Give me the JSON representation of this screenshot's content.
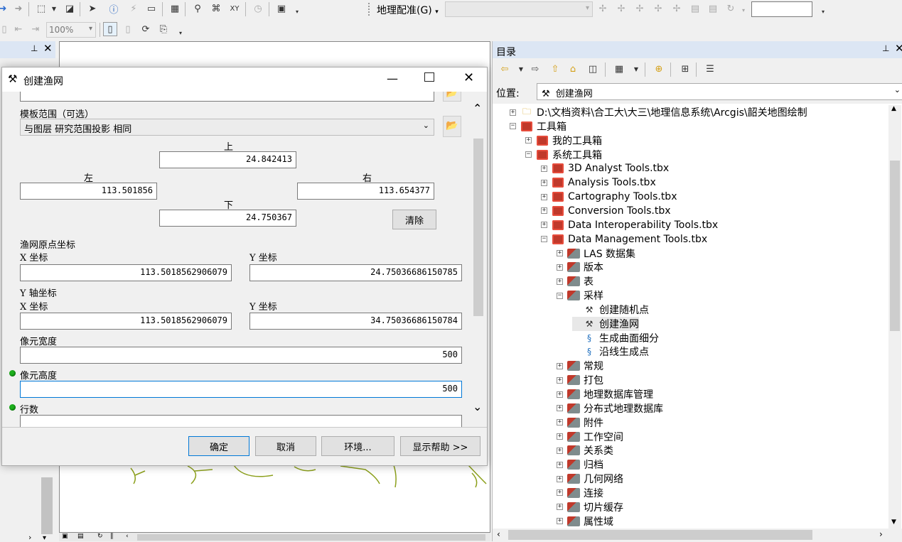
{
  "toolbar": {
    "zoom_value": "100%",
    "georef_label": "地理配准(G)"
  },
  "left_panel": {
    "pin_icon": "pin-icon",
    "close_icon": "close-icon"
  },
  "dialog": {
    "title": "创建渔网",
    "template_extent_label": "模板范围（可选）",
    "template_extent_value": "与图层 研究范围投影 相同",
    "top_label": "上",
    "top_value": "24.842413",
    "left_label": "左",
    "left_value": "113.501856",
    "right_label": "右",
    "right_value": "113.654377",
    "bottom_label": "下",
    "bottom_value": "24.750367",
    "clear_button": "清除",
    "origin_label": "渔网原点坐标",
    "origin_x_label": "X 坐标",
    "origin_x_value": "113.5018562906079",
    "origin_y_label": "Y 坐标",
    "origin_y_value": "24.75036686150785",
    "yaxis_label": "Y 轴坐标",
    "yaxis_x_label": "X 坐标",
    "yaxis_x_value": "113.5018562906079",
    "yaxis_y_label": "Y 坐标",
    "yaxis_y_value": "34.75036686150784",
    "cell_width_label": "像元宽度",
    "cell_width_value": "500",
    "cell_height_label": "像元高度",
    "cell_height_value": "500",
    "rows_label": "行数",
    "ok_button": "确定",
    "cancel_button": "取消",
    "env_button": "环境...",
    "help_button": "显示帮助 >>"
  },
  "catalog": {
    "title": "目录",
    "location_label": "位置:",
    "location_value": "创建渔网",
    "tree": [
      {
        "label": "D:\\文档资料\\合工大\\大三\\地理信息系统\\Arcgis\\韶关地图绘制",
        "pm": "+",
        "icon": "folder-icon"
      },
      {
        "label": "工具箱",
        "pm": "-",
        "icon": "toolbox-icon"
      },
      {
        "label": "我的工具箱",
        "pm": "+",
        "icon": "toolbox-icon"
      },
      {
        "label": "系统工具箱",
        "pm": "-",
        "icon": "toolbox-icon"
      },
      {
        "label": "3D Analyst Tools.tbx",
        "pm": "+",
        "icon": "toolbox-icon"
      },
      {
        "label": "Analysis Tools.tbx",
        "pm": "+",
        "icon": "toolbox-icon"
      },
      {
        "label": "Cartography Tools.tbx",
        "pm": "+",
        "icon": "toolbox-icon"
      },
      {
        "label": "Conversion Tools.tbx",
        "pm": "+",
        "icon": "toolbox-icon"
      },
      {
        "label": "Data Interoperability Tools.tbx",
        "pm": "+",
        "icon": "toolbox-icon"
      },
      {
        "label": "Data Management Tools.tbx",
        "pm": "-",
        "icon": "toolbox-icon"
      },
      {
        "label": "LAS 数据集",
        "pm": "+",
        "icon": "toolset-icon"
      },
      {
        "label": "版本",
        "pm": "+",
        "icon": "toolset-icon"
      },
      {
        "label": "表",
        "pm": "+",
        "icon": "toolset-icon"
      },
      {
        "label": "采样",
        "pm": "-",
        "icon": "toolset-icon"
      },
      {
        "label": "创建随机点",
        "pm": "",
        "icon": "hammer-icon"
      },
      {
        "label": "创建渔网",
        "pm": "",
        "icon": "hammer-icon"
      },
      {
        "label": "生成曲面细分",
        "pm": "",
        "icon": "script-icon"
      },
      {
        "label": "沿线生成点",
        "pm": "",
        "icon": "script-icon"
      },
      {
        "label": "常规",
        "pm": "+",
        "icon": "toolset-icon"
      },
      {
        "label": "打包",
        "pm": "+",
        "icon": "toolset-icon"
      },
      {
        "label": "地理数据库管理",
        "pm": "+",
        "icon": "toolset-icon"
      },
      {
        "label": "分布式地理数据库",
        "pm": "+",
        "icon": "toolset-icon"
      },
      {
        "label": "附件",
        "pm": "+",
        "icon": "toolset-icon"
      },
      {
        "label": "工作空间",
        "pm": "+",
        "icon": "toolset-icon"
      },
      {
        "label": "关系类",
        "pm": "+",
        "icon": "toolset-icon"
      },
      {
        "label": "归档",
        "pm": "+",
        "icon": "toolset-icon"
      },
      {
        "label": "几何网络",
        "pm": "+",
        "icon": "toolset-icon"
      },
      {
        "label": "连接",
        "pm": "+",
        "icon": "toolset-icon"
      },
      {
        "label": "切片缓存",
        "pm": "+",
        "icon": "toolset-icon"
      },
      {
        "label": "属性域",
        "pm": "+",
        "icon": "toolset-icon"
      }
    ]
  }
}
